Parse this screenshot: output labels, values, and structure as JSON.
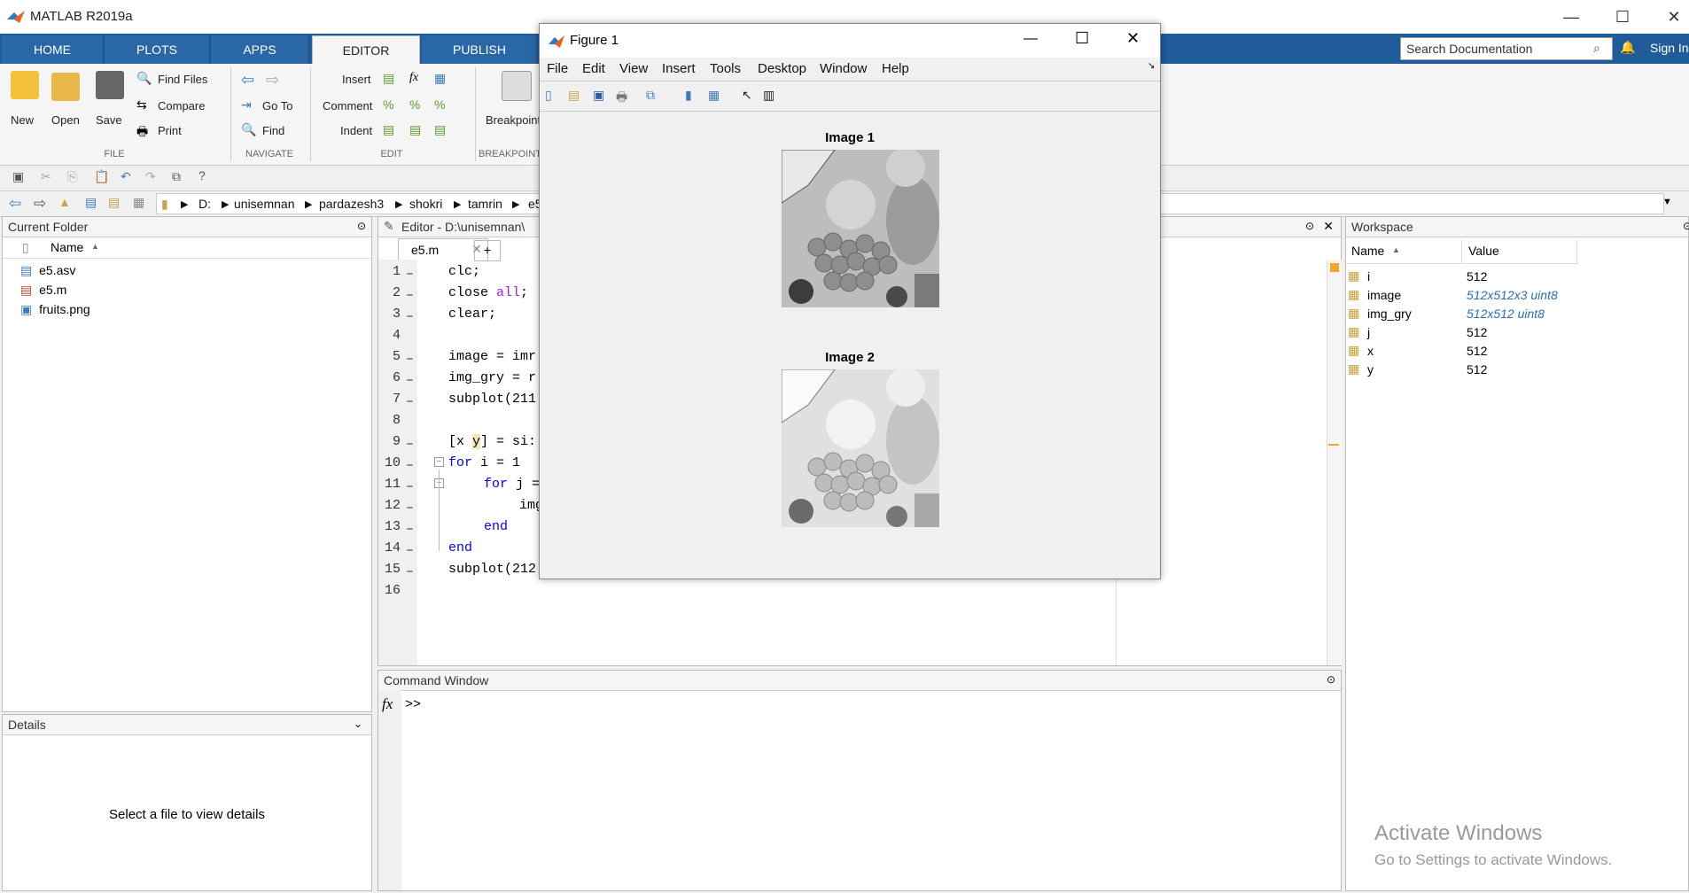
{
  "app": {
    "title": "MATLAB R2019a"
  },
  "ribbon": {
    "tabs": [
      "HOME",
      "PLOTS",
      "APPS",
      "EDITOR",
      "PUBLISH"
    ],
    "active_tab": "EDITOR",
    "search_placeholder": "Search Documentation",
    "sign_in": "Sign In",
    "file": {
      "new": "New",
      "open": "Open",
      "save": "Save",
      "find_files": "Find Files",
      "compare": "Compare",
      "print": "Print",
      "group": "FILE"
    },
    "navigate": {
      "go_to": "Go To",
      "find": "Find",
      "group": "NAVIGATE"
    },
    "edit": {
      "insert": "Insert",
      "comment": "Comment",
      "indent": "Indent",
      "group": "EDIT"
    },
    "breakpoints": {
      "label": "Breakpoints",
      "group": "BREAKPOINTS"
    }
  },
  "address": {
    "drive": "D:",
    "crumbs": [
      "unisemnan",
      "pardazesh3",
      "shokri",
      "tamrin",
      "e5"
    ]
  },
  "current_folder": {
    "title": "Current Folder",
    "column": "Name",
    "files": [
      "e5.asv",
      "e5.m",
      "fruits.png"
    ]
  },
  "details": {
    "title": "Details",
    "message": "Select a file to view details"
  },
  "editor": {
    "title": "Editor - D:\\unisemnan\\",
    "tab": "e5.m",
    "line_numbers": [
      "1",
      "2",
      "3",
      "4",
      "5",
      "6",
      "7",
      "8",
      "9",
      "10",
      "11",
      "12",
      "13",
      "14",
      "15",
      "16"
    ],
    "lines": {
      "l1": "clc;",
      "l2a": "close ",
      "l2b": "all",
      "l2c": ";",
      "l3": "clear;",
      "l5": "image = imr",
      "l6": "img_gry = r",
      "l7": "subplot(211",
      "l9a": "[x ",
      "l9b": "y",
      "l9c": "] = si:",
      "l10a": "for",
      "l10b": " i = 1",
      "l11a": "for",
      "l11b": " j =",
      "l12": "img",
      "l13": "end",
      "l14": "end",
      "l15": "subplot(212"
    }
  },
  "command_window": {
    "title": "Command Window",
    "prompt": ">>"
  },
  "workspace": {
    "title": "Workspace",
    "col_name": "Name",
    "col_value": "Value",
    "vars": [
      {
        "name": "i",
        "value": "512"
      },
      {
        "name": "image",
        "value": "512x512x3 uint8"
      },
      {
        "name": "img_gry",
        "value": "512x512 uint8"
      },
      {
        "name": "j",
        "value": "512"
      },
      {
        "name": "x",
        "value": "512"
      },
      {
        "name": "y",
        "value": "512"
      }
    ]
  },
  "figure": {
    "title": "Figure 1",
    "menu": [
      "File",
      "Edit",
      "View",
      "Insert",
      "Tools",
      "Desktop",
      "Window",
      "Help"
    ],
    "image1_title": "Image 1",
    "image2_title": "Image 2"
  },
  "watermark": {
    "line1": "Activate Windows",
    "line2": "Go to Settings to activate Windows."
  }
}
